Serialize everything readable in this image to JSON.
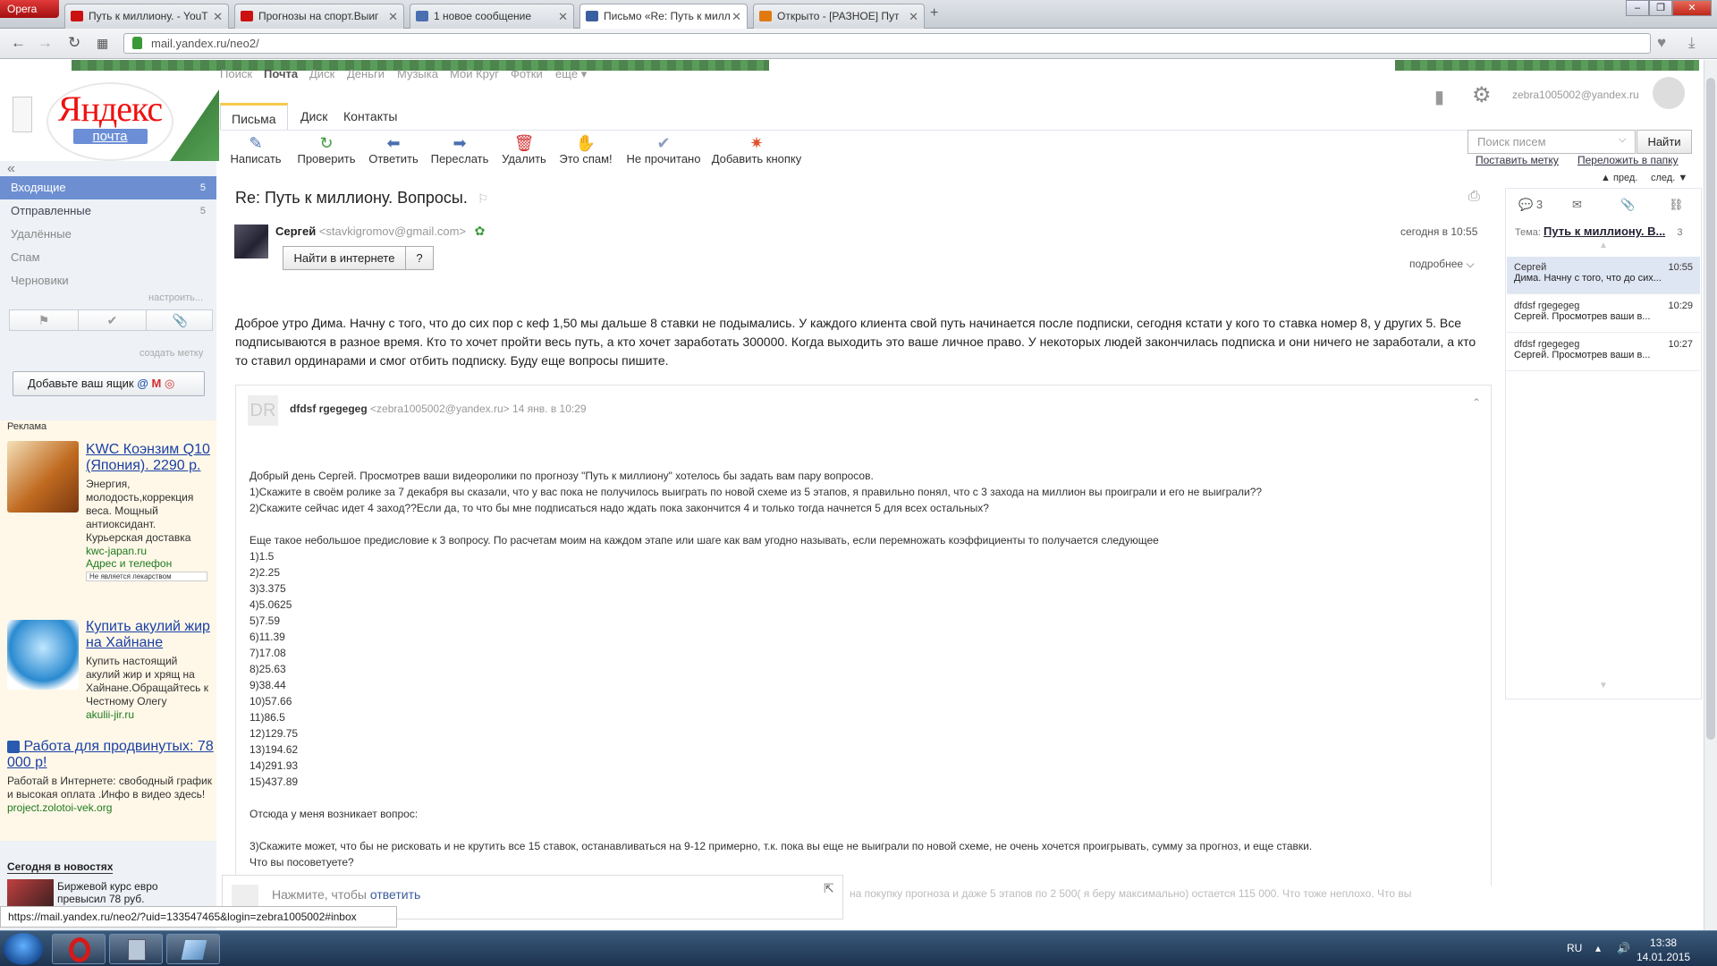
{
  "browser": {
    "opera_label": "Opera",
    "tabs": [
      {
        "title": "Путь к миллиону. - YouT",
        "color": "#cc1111"
      },
      {
        "title": "Прогнозы на спорт.Выиг",
        "color": "#cc1111"
      },
      {
        "title": "1 новое сообщение",
        "color": "#4a6fb0"
      },
      {
        "title": "Письмо «Re: Путь к милл",
        "color": "#3a5fa0"
      },
      {
        "title": "Открыто - [РАЗНОЕ] Пут",
        "color": "#e07a10"
      }
    ],
    "new_tab": "+",
    "url": "mail.yandex.ru/neo2/"
  },
  "header": {
    "logo_text": "Яндекс",
    "logo_sub": "почта",
    "services": [
      "Поиск",
      "Почта",
      "Диск",
      "Деньги",
      "Музыка",
      "Мой Круг",
      "Фотки",
      "ещё ▾"
    ],
    "current_service": "Почта",
    "user_email": "zebra1005002@yandex.ru",
    "mail_tabs": [
      "Письма",
      "Диск",
      "Контакты"
    ],
    "active_tab": "Письма",
    "toolbar": [
      {
        "label": "Написать",
        "icon": "✎",
        "color": "#4a6fb0"
      },
      {
        "label": "Проверить",
        "icon": "↻",
        "color": "#3a9a3a"
      },
      {
        "label": "Ответить",
        "icon": "⬅",
        "color": "#4a6fb0"
      },
      {
        "label": "Переслать",
        "icon": "➡",
        "color": "#4a6fb0"
      },
      {
        "label": "Удалить",
        "icon": "🗑",
        "color": "#d03030"
      },
      {
        "label": "Это спам!",
        "icon": "✋",
        "color": "#f0a020"
      },
      {
        "label": "Не прочитано",
        "icon": "✔",
        "color": "#8aa0c0"
      },
      {
        "label": "Добавить кнопку",
        "icon": "✷",
        "color": "#e05030"
      }
    ],
    "search_placeholder": "Поиск писем",
    "search_button": "Найти",
    "set_label": "Поставить метку",
    "move_folder": "Переложить в папку",
    "prev": "пред.",
    "next": "след."
  },
  "sidebar": {
    "collapse": "«",
    "folders": [
      {
        "name": "Входящие",
        "count": "5"
      },
      {
        "name": "Отправленные",
        "count": "5"
      },
      {
        "name": "Удалённые",
        "count": ""
      },
      {
        "name": "Спам",
        "count": ""
      },
      {
        "name": "Черновики",
        "count": ""
      }
    ],
    "configure": "настроить...",
    "create_label": "создать метку",
    "add_box": "Добавьте ваш ящик",
    "ads_header": "Реклама",
    "ads": [
      {
        "title": "KWC Коэнзим Q10 (Япония). 2290 р.",
        "text": "Энергия, молодость,коррекция веса. Мощный антиоксидант. Курьерская доставка",
        "url": "kwc-japan.ru",
        "extra": "Адрес и телефон",
        "note": "Не является лекарством"
      },
      {
        "title": "Купить акулий жир на Хайнане",
        "text": "Купить настоящий акулий жир и хрящ на Хайнане.Обращайтесь к Честному Олегу",
        "url": "akulii-jir.ru"
      },
      {
        "title": "Работа для продвинутых: 78 000 р!",
        "text": "Работай в Интернете: свободный график и высокая оплата .Инфо в видео здесь!",
        "url": "project.zolotoi-vek.org"
      }
    ],
    "news_header": "Сегодня в новостях",
    "news_item": "Биржевой курс евро превысил 78 руб."
  },
  "message": {
    "subject": "Re: Путь к миллиону. Вопросы.",
    "sender_name": "Сергей",
    "sender_email": "<stavkigromov@gmail.com>",
    "date": "сегодня в 10:55",
    "find_online": "Найти в интернете",
    "question": "?",
    "more": "подробнее",
    "body": "Доброе утро Дима. Начну с того, что до сих пор с кеф 1,50 мы дальше 8 ставки не подымались. У каждого клиента свой путь начинается после подписки, сегодня кстати у кого то ставка номер 8, у других 5. Все подписываются в разное время. Кто то хочет пройти весь путь, а кто хочет заработать 300000. Когда выходить это ваше личное право. У некоторых людей закончилась подписка и они ничего не заработали, а кто то ставил ординарами и смог отбить подписку. Буду еще вопросы пишите.",
    "quoted": {
      "avatar": "DR",
      "sender_name": "dfdsf rgegegeg",
      "sender_email": "<zebra1005002@yandex.ru>",
      "date": "14 янв. в 10:29",
      "body": "Добрый день Сергей. Просмотрев ваши видеоролики по прогнозу \"Путь к миллиону\" хотелось бы задать вам пару вопросов.\n1)Скажите в своём ролике за 7 декабря вы сказали, что у вас пока не получилось выиграть по новой схеме из 5 этапов, я правильно понял, что с 3 захода на миллион вы проиграли и его не выиграли??\n2)Скажите сейчас идет 4 заход??Если да, то что бы мне подписаться надо ждать пока закончится 4 и только тогда начнется 5 для всех остальных?\n\nЕще такое небольшое предисловие к 3 вопросу. По расчетам моим на каждом этапе или шаге как вам угодно называть, если перемножать коэффициенты то получается следующее\n1)1.5\n2)2.25\n3)3.375\n4)5.0625\n5)7.59\n6)11.39\n7)17.08\n8)25.63\n9)38.44\n10)57.66\n11)86.5\n12)129.75\n13)194.62\n14)291.93\n15)437.89\n\nОтсюда у меня возникает вопрос:\n\n3)Скажите может, что бы не рисковать и не крутить все 15 ставок, останавливаться на 9-12 примерно, т.к. пока вы еще не выиграли по новой схеме, не очень хочется проигрывать, сумму за прогноз, и еще ставки.\nЧто вы посоветуете?"
    },
    "reply_prefix": "Нажмите, чтобы",
    "reply_link": "ответить",
    "faded_text": "на покупку прогноза и даже 5 этапов по 2 500( я беру максимально) остается 115 000. Что тоже неплохо. Что вы"
  },
  "thread": {
    "count": "3",
    "tema_label": "Тема:",
    "tema": "Путь к миллиону. В...",
    "tema_count": "3",
    "items": [
      {
        "name": "Сергей",
        "time": "10:55",
        "preview": "Дима. Начну с того, что до сих..."
      },
      {
        "name": "dfdsf rgegegeg",
        "time": "10:29",
        "preview": "Сергей. Просмотрев ваши в..."
      },
      {
        "name": "dfdsf rgegegeg",
        "time": "10:27",
        "preview": "Сергей. Просмотрев ваши в..."
      }
    ]
  },
  "status_url": "https://mail.yandex.ru/neo2/?uid=133547465&login=zebra1005002#inbox",
  "taskbar": {
    "lang": "RU",
    "time": "13:38",
    "date": "14.01.2015"
  }
}
